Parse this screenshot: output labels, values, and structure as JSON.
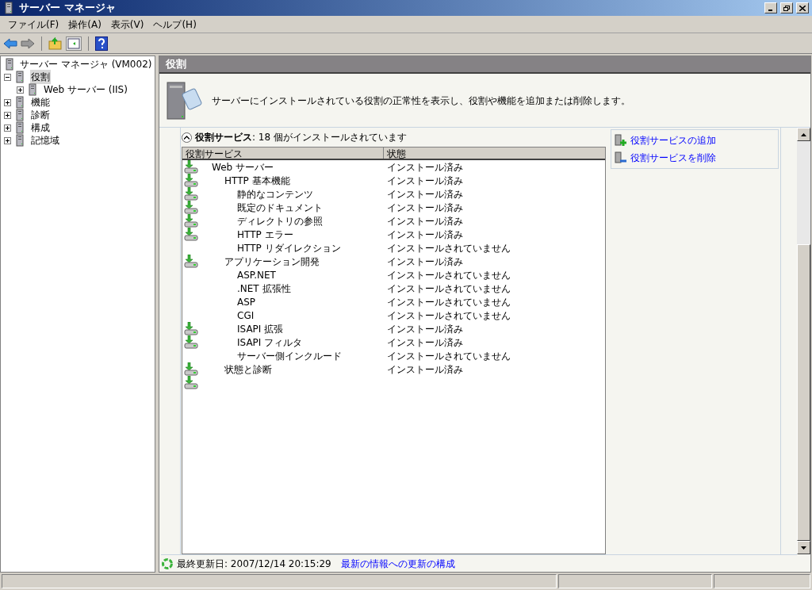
{
  "window": {
    "title": "サーバー マネージャ"
  },
  "menu": [
    "ファイル(F)",
    "操作(A)",
    "表示(V)",
    "ヘルプ(H)"
  ],
  "tree": {
    "label": "サーバー マネージャ (VM002)",
    "items": [
      {
        "label": "役割",
        "expanded": true,
        "selected": true,
        "children": [
          {
            "label": "Web サーバー (IIS)",
            "expanded": false,
            "selected": false
          }
        ]
      },
      {
        "label": "機能",
        "expanded": false,
        "selected": false
      },
      {
        "label": "診断",
        "expanded": false,
        "selected": false
      },
      {
        "label": "構成",
        "expanded": false,
        "selected": false
      },
      {
        "label": "記憶域",
        "expanded": false,
        "selected": false
      }
    ]
  },
  "panel": {
    "title": "役割",
    "description": "サーバーにインストールされている役割の正常性を表示し、役割や機能を追加または削除します。",
    "section": {
      "title": "役割サービス",
      "summary": ": 18 個がインストールされています",
      "expanded": true
    },
    "table": {
      "columns": [
        "役割サービス",
        "状態"
      ],
      "trailing_installed_icon": true,
      "rows": [
        {
          "name": "Web サーバー",
          "status": "インストール済み",
          "installed": true,
          "children": [
            {
              "name": "HTTP 基本機能",
              "status": "インストール済み",
              "installed": true,
              "children": [
                {
                  "name": "静的なコンテンツ",
                  "status": "インストール済み",
                  "installed": true
                },
                {
                  "name": "既定のドキュメント",
                  "status": "インストール済み",
                  "installed": true
                },
                {
                  "name": "ディレクトリの参照",
                  "status": "インストール済み",
                  "installed": true
                },
                {
                  "name": "HTTP エラー",
                  "status": "インストール済み",
                  "installed": true
                },
                {
                  "name": "HTTP リダイレクション",
                  "status": "インストールされていません",
                  "installed": false
                }
              ]
            },
            {
              "name": "アプリケーション開発",
              "status": "インストール済み",
              "installed": true,
              "children": [
                {
                  "name": "ASP.NET",
                  "status": "インストールされていません",
                  "installed": false
                },
                {
                  "name": ".NET 拡張性",
                  "status": "インストールされていません",
                  "installed": false
                },
                {
                  "name": "ASP",
                  "status": "インストールされていません",
                  "installed": false
                },
                {
                  "name": "CGI",
                  "status": "インストールされていません",
                  "installed": false
                },
                {
                  "name": "ISAPI 拡張",
                  "status": "インストール済み",
                  "installed": true
                },
                {
                  "name": "ISAPI フィルタ",
                  "status": "インストール済み",
                  "installed": true
                },
                {
                  "name": "サーバー側インクルード",
                  "status": "インストールされていません",
                  "installed": false
                }
              ]
            },
            {
              "name": "状態と診断",
              "status": "インストール済み",
              "installed": true
            }
          ]
        }
      ]
    },
    "actions": [
      {
        "label": "役割サービスの追加",
        "kind": "add"
      },
      {
        "label": "役割サービスを削除",
        "kind": "remove"
      }
    ],
    "footer": {
      "label": "最終更新日: 2007/12/14 20:15:29",
      "link": "最新の情報への更新の構成"
    }
  }
}
